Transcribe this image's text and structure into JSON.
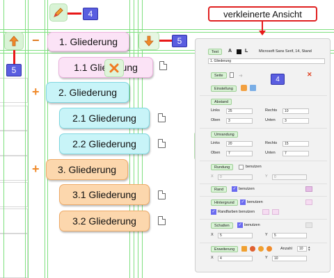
{
  "callout": {
    "label": "verkleinerte Ansicht"
  },
  "badges": {
    "top": "4",
    "right_arrow": "5",
    "left_arrow": "5",
    "panel": "4"
  },
  "nodes": [
    {
      "label": "1. Gliederung"
    },
    {
      "label": "1.1 Gliederung"
    },
    {
      "label": "2. Gliederung"
    },
    {
      "label": "2.1 Gliederung"
    },
    {
      "label": "2.2 Gliederung"
    },
    {
      "label": "3. Gliederung"
    },
    {
      "label": "3.1 Gliederung"
    },
    {
      "label": "3.2 Gliederung"
    }
  ],
  "toggles": {
    "minus": "−",
    "plus": "+"
  },
  "panel": {
    "text_button": "Text",
    "font_a_plain": "A",
    "font_l_bold": "L",
    "font_info": "Microsoft Sans Serif, 14, Stand",
    "text_value": "1. Gliederung",
    "seite_button": "Seite",
    "einstellung_button": "Einstellung",
    "abstand_button": "Abstand",
    "links_label": "Links",
    "rechts_label": "Rechts",
    "oben_label": "Oben",
    "unten_label": "Unten",
    "abstand_links": "25",
    "abstand_rechts": "10",
    "abstand_oben": "3",
    "abstand_unten": "3",
    "umrandung_button": "Umrandung",
    "umrandung_links": "20",
    "umrandung_rechts": "15",
    "umrandung_oben": "7",
    "umrandung_unten": "7",
    "rundung_button": "Rundung",
    "benutzen": "benutzen",
    "x_label": "X",
    "y_label": "Y",
    "rundung_x": "0",
    "rundung_y": "0",
    "rand_button": "Rand",
    "hintergrund_button": "Hintergrund",
    "randfarben_benutzen": "Randfarben benutzen",
    "schatten_button": "Schatten",
    "schatten_x": "5",
    "schatten_y": "5",
    "erweiterung_button": "Erweiterung",
    "anzahl_label": "Anzahl",
    "anzahl_value": "10",
    "erw_x": "4",
    "erw_y": "10",
    "check_mark": "✓"
  }
}
